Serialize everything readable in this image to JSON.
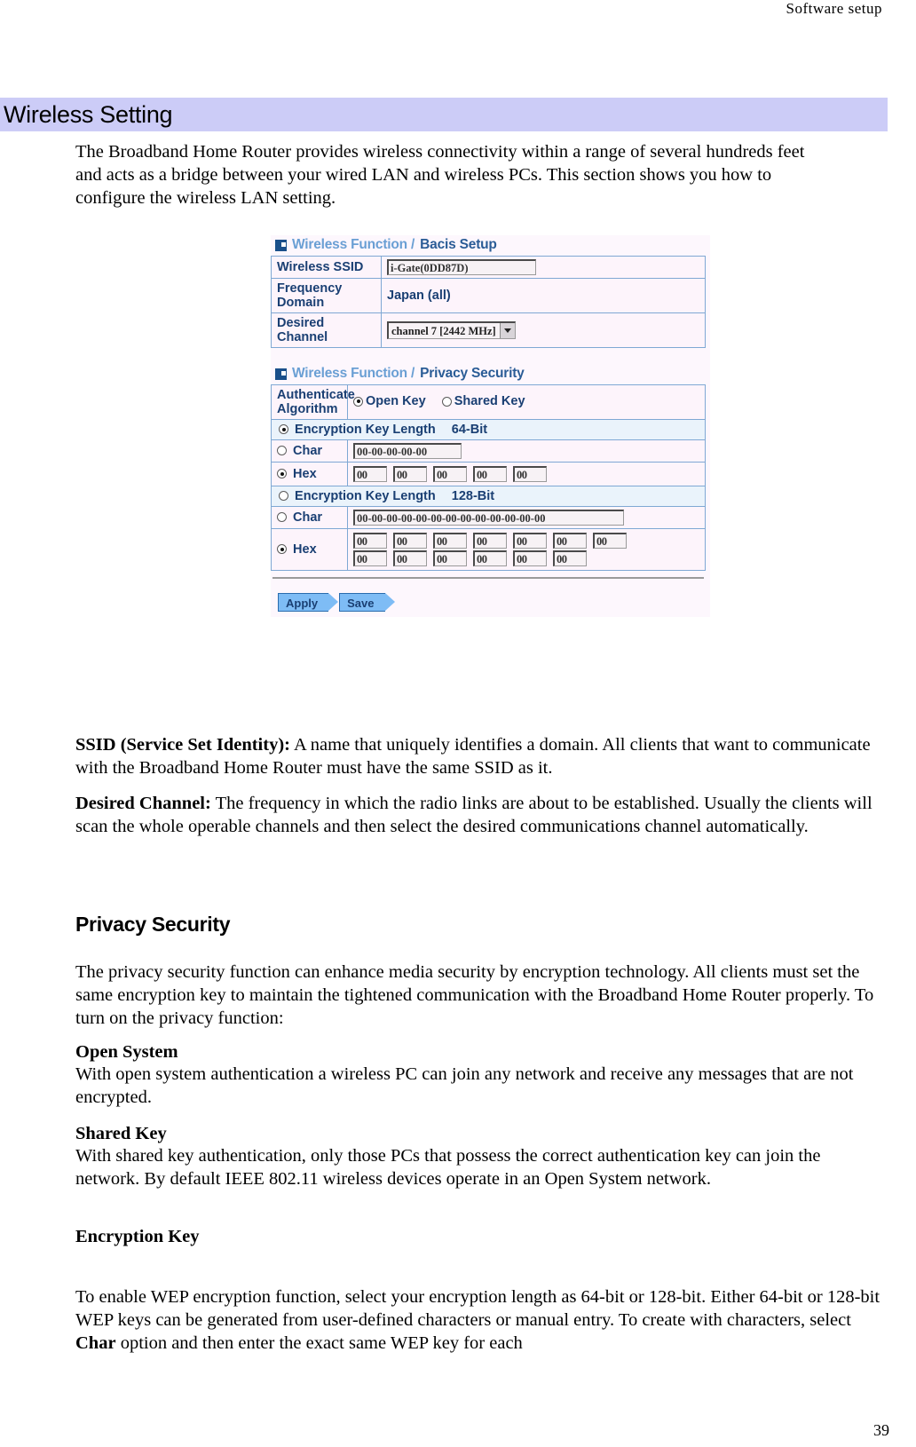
{
  "running_head": "Software  setup",
  "banner": {
    "title": "Wireless Setting"
  },
  "intro": "The Broadband Home Router provides wireless connectivity within a range of several hundreds feet and acts as a bridge between your wired LAN and wireless PCs. This section shows you how to configure the wireless LAN setting.",
  "router_ui": {
    "basic_panel": {
      "head_prefix": "Wireless Function / ",
      "head_suffix": "Bacis Setup",
      "rows": [
        {
          "label": "Wireless SSID",
          "value": "i-Gate(0DD87D)"
        },
        {
          "label": "Frequency Domain",
          "value": "Japan (all)"
        },
        {
          "label": "Desired Channel",
          "value": "channel 7 [2442 MHz]"
        }
      ]
    },
    "privacy_panel": {
      "head_prefix": "Wireless Function / ",
      "head_suffix": "Privacy Security",
      "auth_label_line1": "Authenticate",
      "auth_label_line2": "Algorithm",
      "auth_open": "Open Key",
      "auth_shared": "Shared Key",
      "key64_label": "Encryption Key Length",
      "key64_value": "64-Bit",
      "key128_label": "Encryption Key Length",
      "key128_value": "128-Bit",
      "char_label": "Char",
      "hex_label": "Hex",
      "char64_value": "00-00-00-00-00",
      "char128_value": "00-00-00-00-00-00-00-00-00-00-00-00-00",
      "hex64_values": [
        "00",
        "00",
        "00",
        "00",
        "00"
      ],
      "hex128_row1": [
        "00",
        "00",
        "00",
        "00",
        "00",
        "00",
        "00"
      ],
      "hex128_row2": [
        "00",
        "00",
        "00",
        "00",
        "00",
        "00"
      ]
    },
    "buttons": {
      "apply": "Apply",
      "save": "Save"
    }
  },
  "body": {
    "ssid_term": "SSID (Service Set Identity):",
    "ssid_text": " A name that uniquely identifies a domain. All clients that want to communicate with the Broadband Home Router must have the same SSID as it.",
    "channel_term": "Desired Channel:",
    "channel_text": " The frequency in which the radio links are about to be established. Usually the clients will scan the whole operable channels and then select the desired communications channel automatically.",
    "privacy_heading": "Privacy Security",
    "privacy_para": "The privacy security function can enhance media security by encryption technology. All clients must set the same encryption key to maintain the tightened communication with the Broadband Home Router properly. To turn on the privacy function:",
    "open_system_heading": "Open System",
    "open_system_text": "With open system authentication a wireless PC can join any network and receive any messages that are not encrypted.",
    "shared_key_heading": "Shared Key",
    "shared_key_text": "With shared key authentication, only those PCs that possess the correct authentication key can join the network. By default IEEE 802.11 wireless devices operate in an Open System network.",
    "encryption_key_heading": "Encryption Key",
    "encryption_para_1": "To enable WEP encryption function, select your encryption length as 64-bit or 128-bit. Either 64-bit or 128-bit WEP keys can be generated from user-defined characters or manual entry. To create with characters, select ",
    "encryption_bold": "Char",
    "encryption_para_2": " option and then enter the exact same WEP key for each"
  },
  "page_number": "39"
}
